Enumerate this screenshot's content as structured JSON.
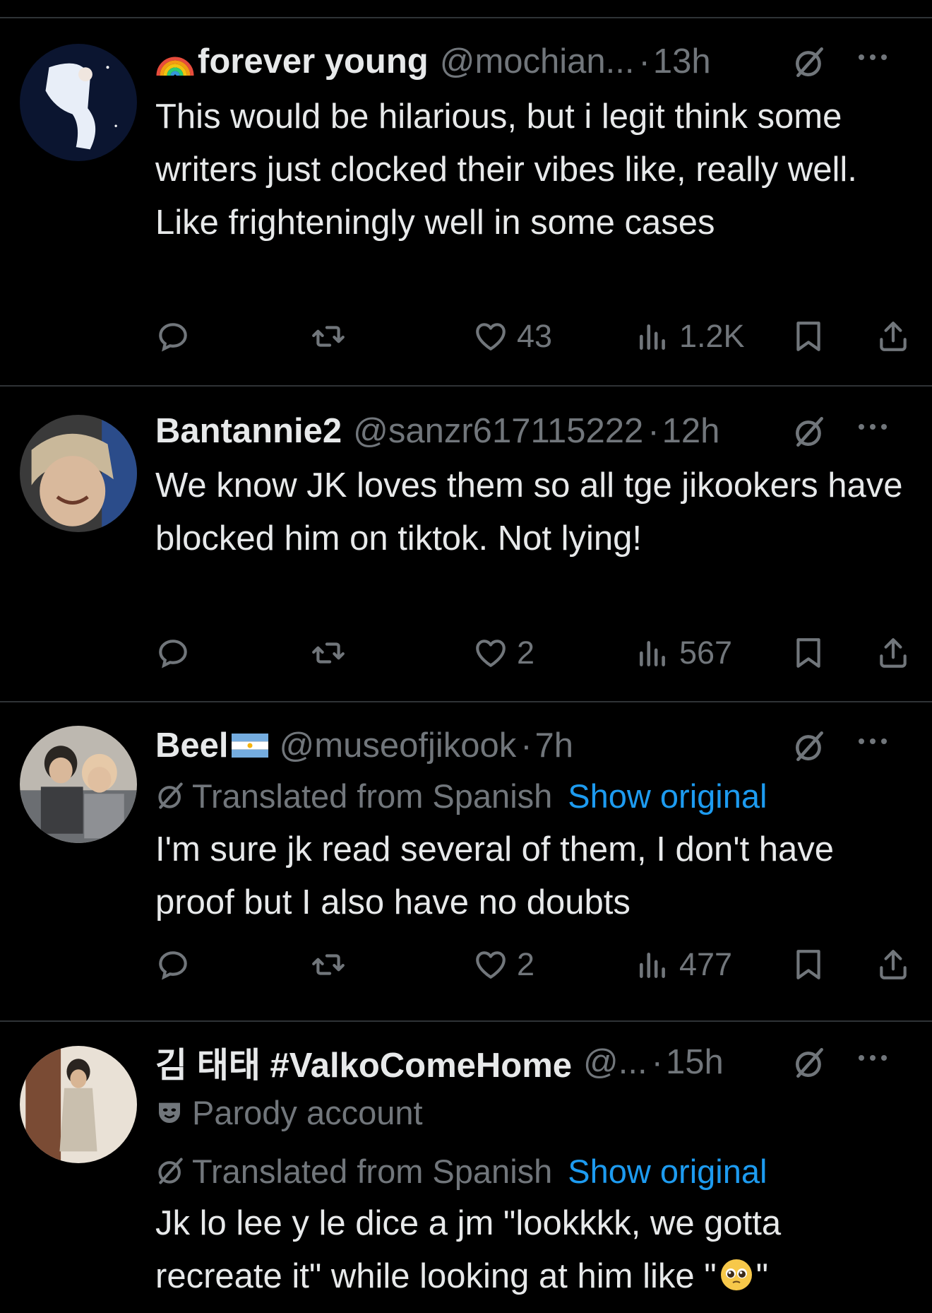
{
  "tweets": [
    {
      "name": "forever young",
      "handle": "@mochian...",
      "time": "13h",
      "text": "This would be hilarious, but i legit think some writers just clocked their vibes like, really well. Like frighteningly well in some cases",
      "likes": "43",
      "views": "1.2K"
    },
    {
      "name": "Bantannie2",
      "handle": "@sanzr617115222",
      "time": "12h",
      "text": "We know JK loves them so all tge jikookers have blocked him on tiktok. Not lying!",
      "likes": "2",
      "views": "567"
    },
    {
      "name": "Beel",
      "handle": "@museofjikook",
      "time": "7h",
      "translated": "Translated from Spanish",
      "show_original": "Show original",
      "text": "I'm sure jk read several of them, I don't have proof but I also have no doubts",
      "likes": "2",
      "views": "477"
    },
    {
      "name": "김 태태 #ValkoComeHome",
      "handle": "@...",
      "time": "15h",
      "parody": "Parody account",
      "translated": "Translated from Spanish",
      "show_original": "Show original",
      "text": "Jk lo lee y le dice a jm \"lookkkk, we gotta recreate it\" while looking at him like \"",
      "text_end": "\""
    }
  ],
  "separator": "·",
  "colors": {
    "background": "#000000",
    "text": "#e7e9ea",
    "muted": "#71767b",
    "link": "#1d9bf0",
    "divider": "#2f3336"
  },
  "icons": [
    "rainbow-icon",
    "argentina-flag-icon",
    "grok-icon",
    "more-icon",
    "reply-icon",
    "retweet-icon",
    "like-icon",
    "views-icon",
    "bookmark-icon",
    "share-icon",
    "parody-mask-icon",
    "translate-icon",
    "pleading-face-emoji"
  ]
}
